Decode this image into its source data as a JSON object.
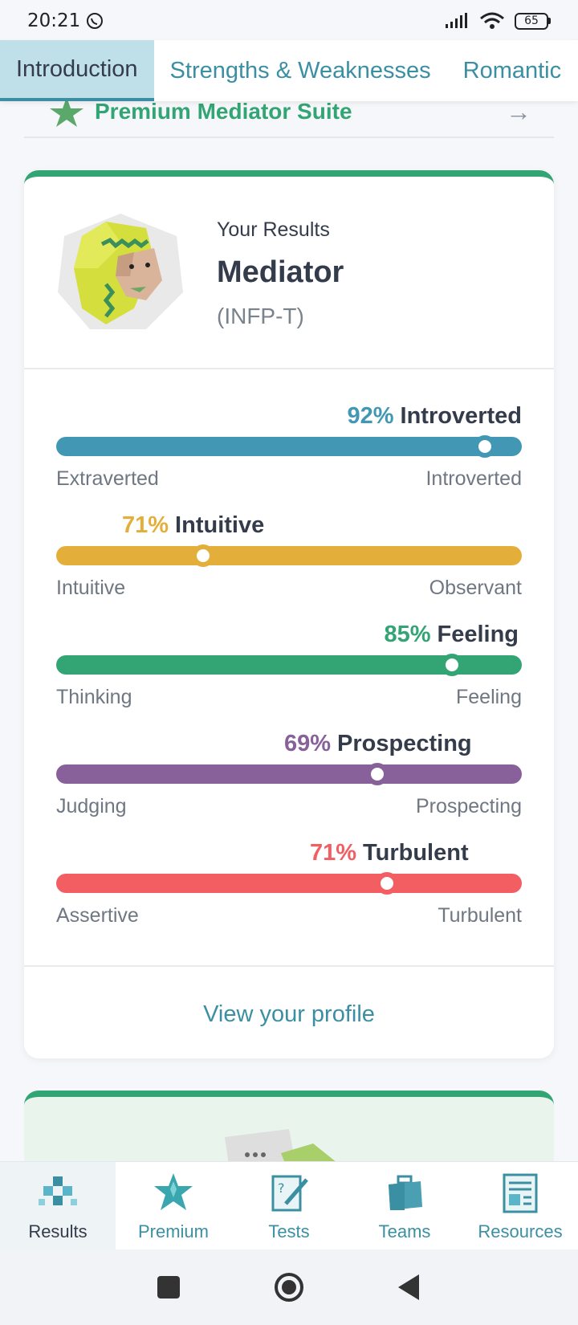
{
  "status": {
    "time": "20:21",
    "battery": "65"
  },
  "tabs": [
    {
      "label": "Introduction",
      "active": true
    },
    {
      "label": "Strengths & Weaknesses",
      "active": false
    },
    {
      "label": "Romantic",
      "active": false
    }
  ],
  "premium": {
    "label": "Premium Mediator Suite"
  },
  "results": {
    "heading": "Your Results",
    "type_name": "Mediator",
    "type_code": "(INFP-T)"
  },
  "traits": [
    {
      "pct": "92%",
      "name": "Introverted",
      "left": "Extraverted",
      "right": "Introverted",
      "position": 0.92,
      "color": "#4298b4"
    },
    {
      "pct": "71%",
      "name": "Intuitive",
      "left": "Intuitive",
      "right": "Observant",
      "position": 0.315,
      "color": "#e4ae3a"
    },
    {
      "pct": "85%",
      "name": "Feeling",
      "left": "Thinking",
      "right": "Feeling",
      "position": 0.85,
      "color": "#33a474"
    },
    {
      "pct": "69%",
      "name": "Prospecting",
      "left": "Judging",
      "right": "Prospecting",
      "position": 0.69,
      "color": "#88619a"
    },
    {
      "pct": "71%",
      "name": "Turbulent",
      "left": "Assertive",
      "right": "Turbulent",
      "position": 0.71,
      "color": "#f25e62"
    }
  ],
  "view_profile": "View your profile",
  "nav": [
    {
      "label": "Results",
      "icon": "results-icon",
      "active": true
    },
    {
      "label": "Premium",
      "icon": "premium-star-icon",
      "active": false
    },
    {
      "label": "Tests",
      "icon": "tests-icon",
      "active": false
    },
    {
      "label": "Teams",
      "icon": "teams-briefcase-icon",
      "active": false
    },
    {
      "label": "Resources",
      "icon": "resources-icon",
      "active": false
    }
  ],
  "colors": {
    "accent": "#3b8fa3",
    "green": "#33a474"
  }
}
